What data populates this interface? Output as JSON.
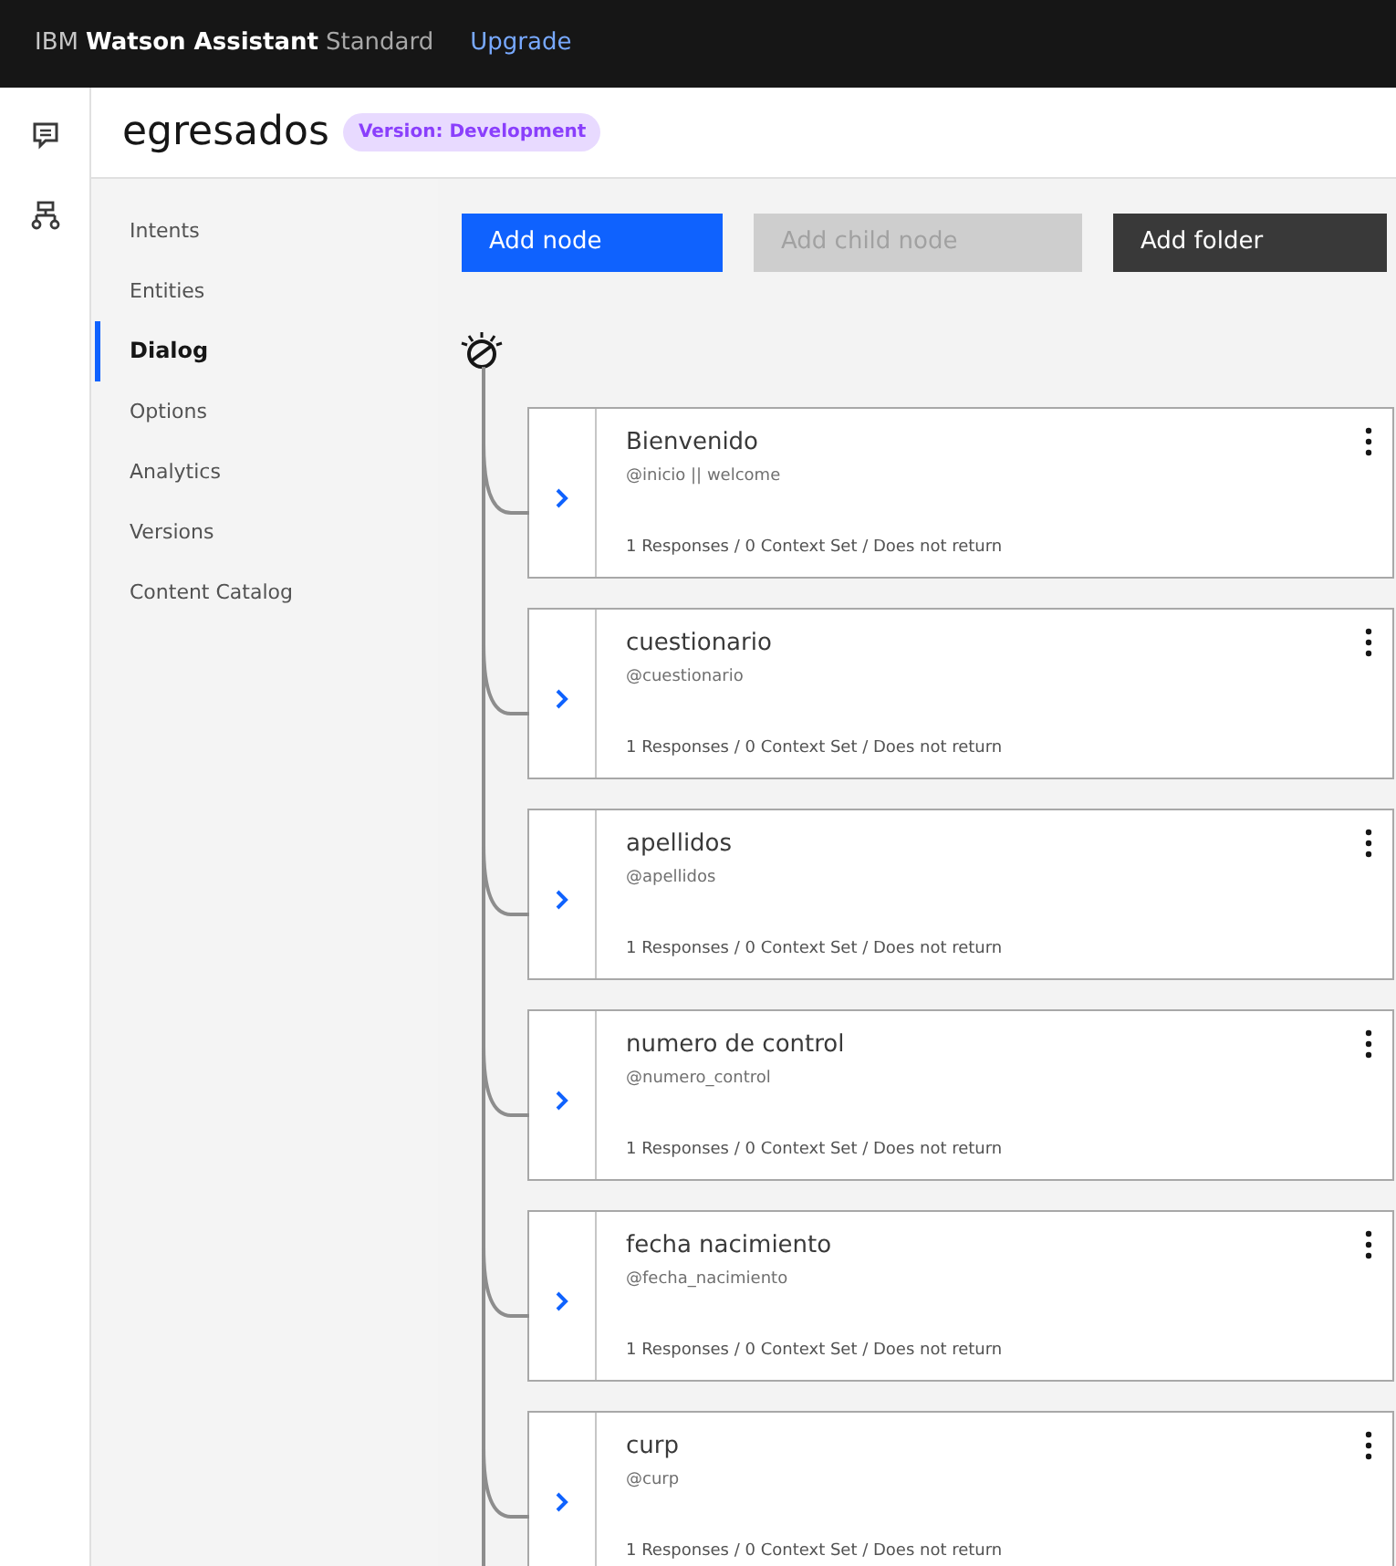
{
  "top_bar": {
    "brand_prefix": "IBM",
    "brand_name": "Watson Assistant",
    "plan": "Standard",
    "upgrade_link": "Upgrade"
  },
  "rail": [
    {
      "kind": "chat",
      "selected": false
    },
    {
      "kind": "hierarchy",
      "selected": false
    }
  ],
  "header": {
    "title": "egresados",
    "version_tag": "Version: Development"
  },
  "nav": [
    {
      "label": "Intents",
      "selected": false
    },
    {
      "label": "Entities",
      "selected": false
    },
    {
      "label": "Dialog",
      "selected": true
    },
    {
      "label": "Options",
      "selected": false
    },
    {
      "label": "Analytics",
      "selected": false
    },
    {
      "label": "Versions",
      "selected": false
    },
    {
      "label": "Content Catalog",
      "selected": false
    }
  ],
  "toolbar": [
    {
      "label": "Add node",
      "kind": "primary",
      "disabled": false
    },
    {
      "label": "Add child node",
      "kind": "secondary",
      "disabled": true
    },
    {
      "label": "Add folder",
      "kind": "dark",
      "disabled": false
    }
  ],
  "nodes": [
    {
      "title": "Bienvenido",
      "condition": "@inicio || welcome",
      "summary": "1 Responses / 0 Context Set / Does not return"
    },
    {
      "title": "cuestionario",
      "condition": "@cuestionario",
      "summary": "1 Responses / 0 Context Set / Does not return"
    },
    {
      "title": "apellidos",
      "condition": "@apellidos",
      "summary": "1 Responses / 0 Context Set / Does not return"
    },
    {
      "title": "numero de control",
      "condition": "@numero_control",
      "summary": "1 Responses / 0 Context Set / Does not return"
    },
    {
      "title": "fecha nacimiento",
      "condition": "@fecha_nacimiento",
      "summary": "1 Responses / 0 Context Set / Does not return"
    },
    {
      "title": "curp",
      "condition": "@curp",
      "summary": "1 Responses / 0 Context Set / Does not return"
    }
  ]
}
